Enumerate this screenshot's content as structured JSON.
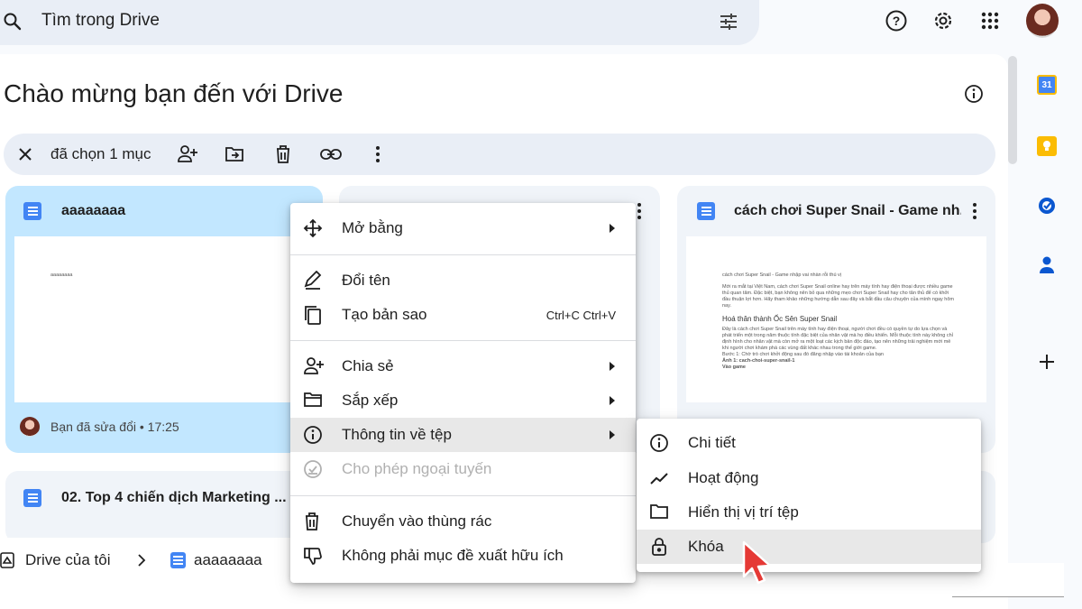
{
  "search": {
    "placeholder": "Tìm trong Drive"
  },
  "header": {
    "icons": [
      "help-icon",
      "settings-icon",
      "apps-icon",
      "avatar"
    ]
  },
  "page": {
    "title": "Chào mừng bạn đến với Drive"
  },
  "selection_bar": {
    "text": "đã chọn 1 mục"
  },
  "cards": [
    {
      "title": "aaaaaaaa",
      "thumb_text": "aaaaaaaa",
      "footer": "Bạn đã sửa đổi • 17:25"
    },
    {
      "title": "cách chơi Super Snail - Game nh..."
    },
    {
      "title": "02. Top 4 chiến dịch Marketing ..."
    }
  ],
  "doc_preview": {
    "line1": "cách chơi Super Snail - Game nhập vai nhàn rỗi thú vị",
    "para1": "Mới ra mắt tại Việt Nam, cách chơi Super Snail online hay trên máy tính hay điện thoại được nhiều game thủ quan tâm. Đặc biệt, bạn không nên bỏ qua những mẹo chơi Super Snail hay cho tân thủ để có khởi đầu thuận lợi hơn. Hãy tham khảo những hướng dẫn sau đây và bắt đầu câu chuyện của mình ngay hôm nay.",
    "heading": "Hoá thân thành Ốc Sên Super Snail",
    "para2": "Đây là cách chơi Super Snail trên máy tính hay điện thoại, người chơi đều có quyền tự do lựa chọn và phát triển một trong năm thuộc tính đặc biệt của nhân vật mà họ điều khiển. Mỗi thuộc tính này không chỉ định hình cho nhân vật mà còn mở ra một loạt các kịch bản độc đáo, tạo nên những trải nghiệm mới mẻ khi người chơi khám phá các vùng đất khác nhau trong thế giới game.",
    "step": "Bước 1: Chờ trò chơi khởi động sau đó đăng nhập vào tài khoản của bạn",
    "img": "Ảnh 1: cach-choi-super-snail-1",
    "vao": "Vào game"
  },
  "context_menu": {
    "items": [
      {
        "label": "Mở bằng",
        "icon": "open-with-icon",
        "submenu": true
      },
      {
        "label": "Đổi tên",
        "icon": "rename-icon"
      },
      {
        "label": "Tạo bản sao",
        "icon": "copy-icon",
        "shortcut": "Ctrl+C Ctrl+V"
      },
      {
        "label": "Chia sẻ",
        "icon": "share-icon",
        "submenu": true
      },
      {
        "label": "Sắp xếp",
        "icon": "organize-icon",
        "submenu": true
      },
      {
        "label": "Thông tin về tệp",
        "icon": "info-icon",
        "submenu": true,
        "highlighted": true
      },
      {
        "label": "Cho phép ngoại tuyến",
        "icon": "offline-icon",
        "disabled": true
      },
      {
        "label": "Chuyển vào thùng rác",
        "icon": "trash-icon"
      },
      {
        "label": "Không phải mục đề xuất hữu ích",
        "icon": "thumb-down-icon"
      }
    ]
  },
  "submenu": {
    "items": [
      {
        "label": "Chi tiết",
        "icon": "details-icon"
      },
      {
        "label": "Hoạt động",
        "icon": "activity-icon"
      },
      {
        "label": "Hiển thị vị trí tệp",
        "icon": "folder-icon"
      },
      {
        "label": "Khóa",
        "icon": "lock-icon",
        "highlighted": true
      }
    ]
  },
  "breadcrumb": {
    "root": "Drive của tôi",
    "file": "aaaaaaaa"
  },
  "colors": {
    "accent": "#0b57d0",
    "selected_card": "#c2e7ff",
    "menu_highlight": "#e8e8e8",
    "doc_blue": "#4285f4"
  }
}
